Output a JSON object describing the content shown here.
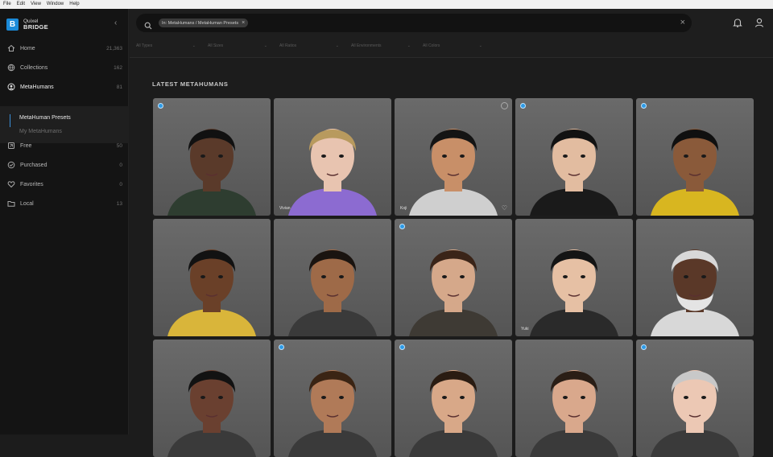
{
  "menubar": {
    "items": [
      "File",
      "Edit",
      "View",
      "Window",
      "Help"
    ]
  },
  "brand": {
    "line1": "Quixel",
    "line2": "BRIDGE",
    "logo_letter": "B"
  },
  "sidebar": {
    "items": [
      {
        "label": "Home",
        "count": "21,363",
        "icon": "home-icon"
      },
      {
        "label": "Collections",
        "count": "162",
        "icon": "globe-icon"
      },
      {
        "label": "MetaHumans",
        "count": "81",
        "icon": "metahuman-icon"
      },
      {
        "label": "Free",
        "count": "50",
        "icon": "free-icon"
      },
      {
        "label": "Purchased",
        "count": "0",
        "icon": "check-circle-icon"
      },
      {
        "label": "Favorites",
        "count": "0",
        "icon": "heart-icon"
      },
      {
        "label": "Local",
        "count": "13",
        "icon": "folder-icon"
      }
    ],
    "subitems": [
      "MetaHuman Presets",
      "My MetaHumans"
    ]
  },
  "search": {
    "chip": "In: MetaHumans / MetaHuman Presets"
  },
  "filters": [
    "All Types",
    "All Sizes",
    "All Ratios",
    "All Environments",
    "All Colors"
  ],
  "main": {
    "section_title": "LATEST METAHUMANS"
  },
  "cards": [
    {
      "skin": "#5a3a2a",
      "hair": "#111111",
      "top": "#2e3d30",
      "badge": true
    },
    {
      "skin": "#e8c4b0",
      "hair": "#b89a5e",
      "top": "#8c6bd1",
      "badge": false,
      "tag": "Vivian"
    },
    {
      "skin": "#c88f68",
      "hair": "#141414",
      "top": "#cfcfcf",
      "badge": false,
      "download": true,
      "fav": true,
      "tag": "Koji"
    },
    {
      "skin": "#e2bca0",
      "hair": "#121212",
      "top": "#1a1a1a",
      "badge": true
    },
    {
      "skin": "#8a5a3a",
      "hair": "#101010",
      "top": "#d8b620",
      "badge": true
    },
    {
      "skin": "#6a4028",
      "hair": "#121212",
      "top": "#d9b53a",
      "badge": false
    },
    {
      "skin": "#9e6a48",
      "hair": "#1a1410",
      "top": "#3a3a3a",
      "badge": false
    },
    {
      "skin": "#d5a88a",
      "hair": "#3a2418",
      "top": "#3e3a34",
      "badge": true
    },
    {
      "skin": "#e6c0a4",
      "hair": "#141414",
      "top": "#2a2a2a",
      "badge": false,
      "tag": "Yuki"
    },
    {
      "skin": "#5a3828",
      "hair": "#d8d8d8",
      "top": "#d8d8d8",
      "badge": false,
      "beard": "#e4e4e4"
    },
    {
      "skin": "#6a4030",
      "hair": "#121212",
      "top": "#3a3a3a",
      "badge": false
    },
    {
      "skin": "#b07a58",
      "hair": "#3a2414",
      "top": "#3a3a3a",
      "badge": true
    },
    {
      "skin": "#d8a888",
      "hair": "#2a1c12",
      "top": "#3a3a3a",
      "badge": true
    },
    {
      "skin": "#d9a88c",
      "hair": "#2a1e16",
      "top": "#3a3a3a",
      "badge": false
    },
    {
      "skin": "#ecc8b4",
      "hair": "#c8c8c8",
      "top": "#3a3a3a",
      "badge": true
    }
  ]
}
